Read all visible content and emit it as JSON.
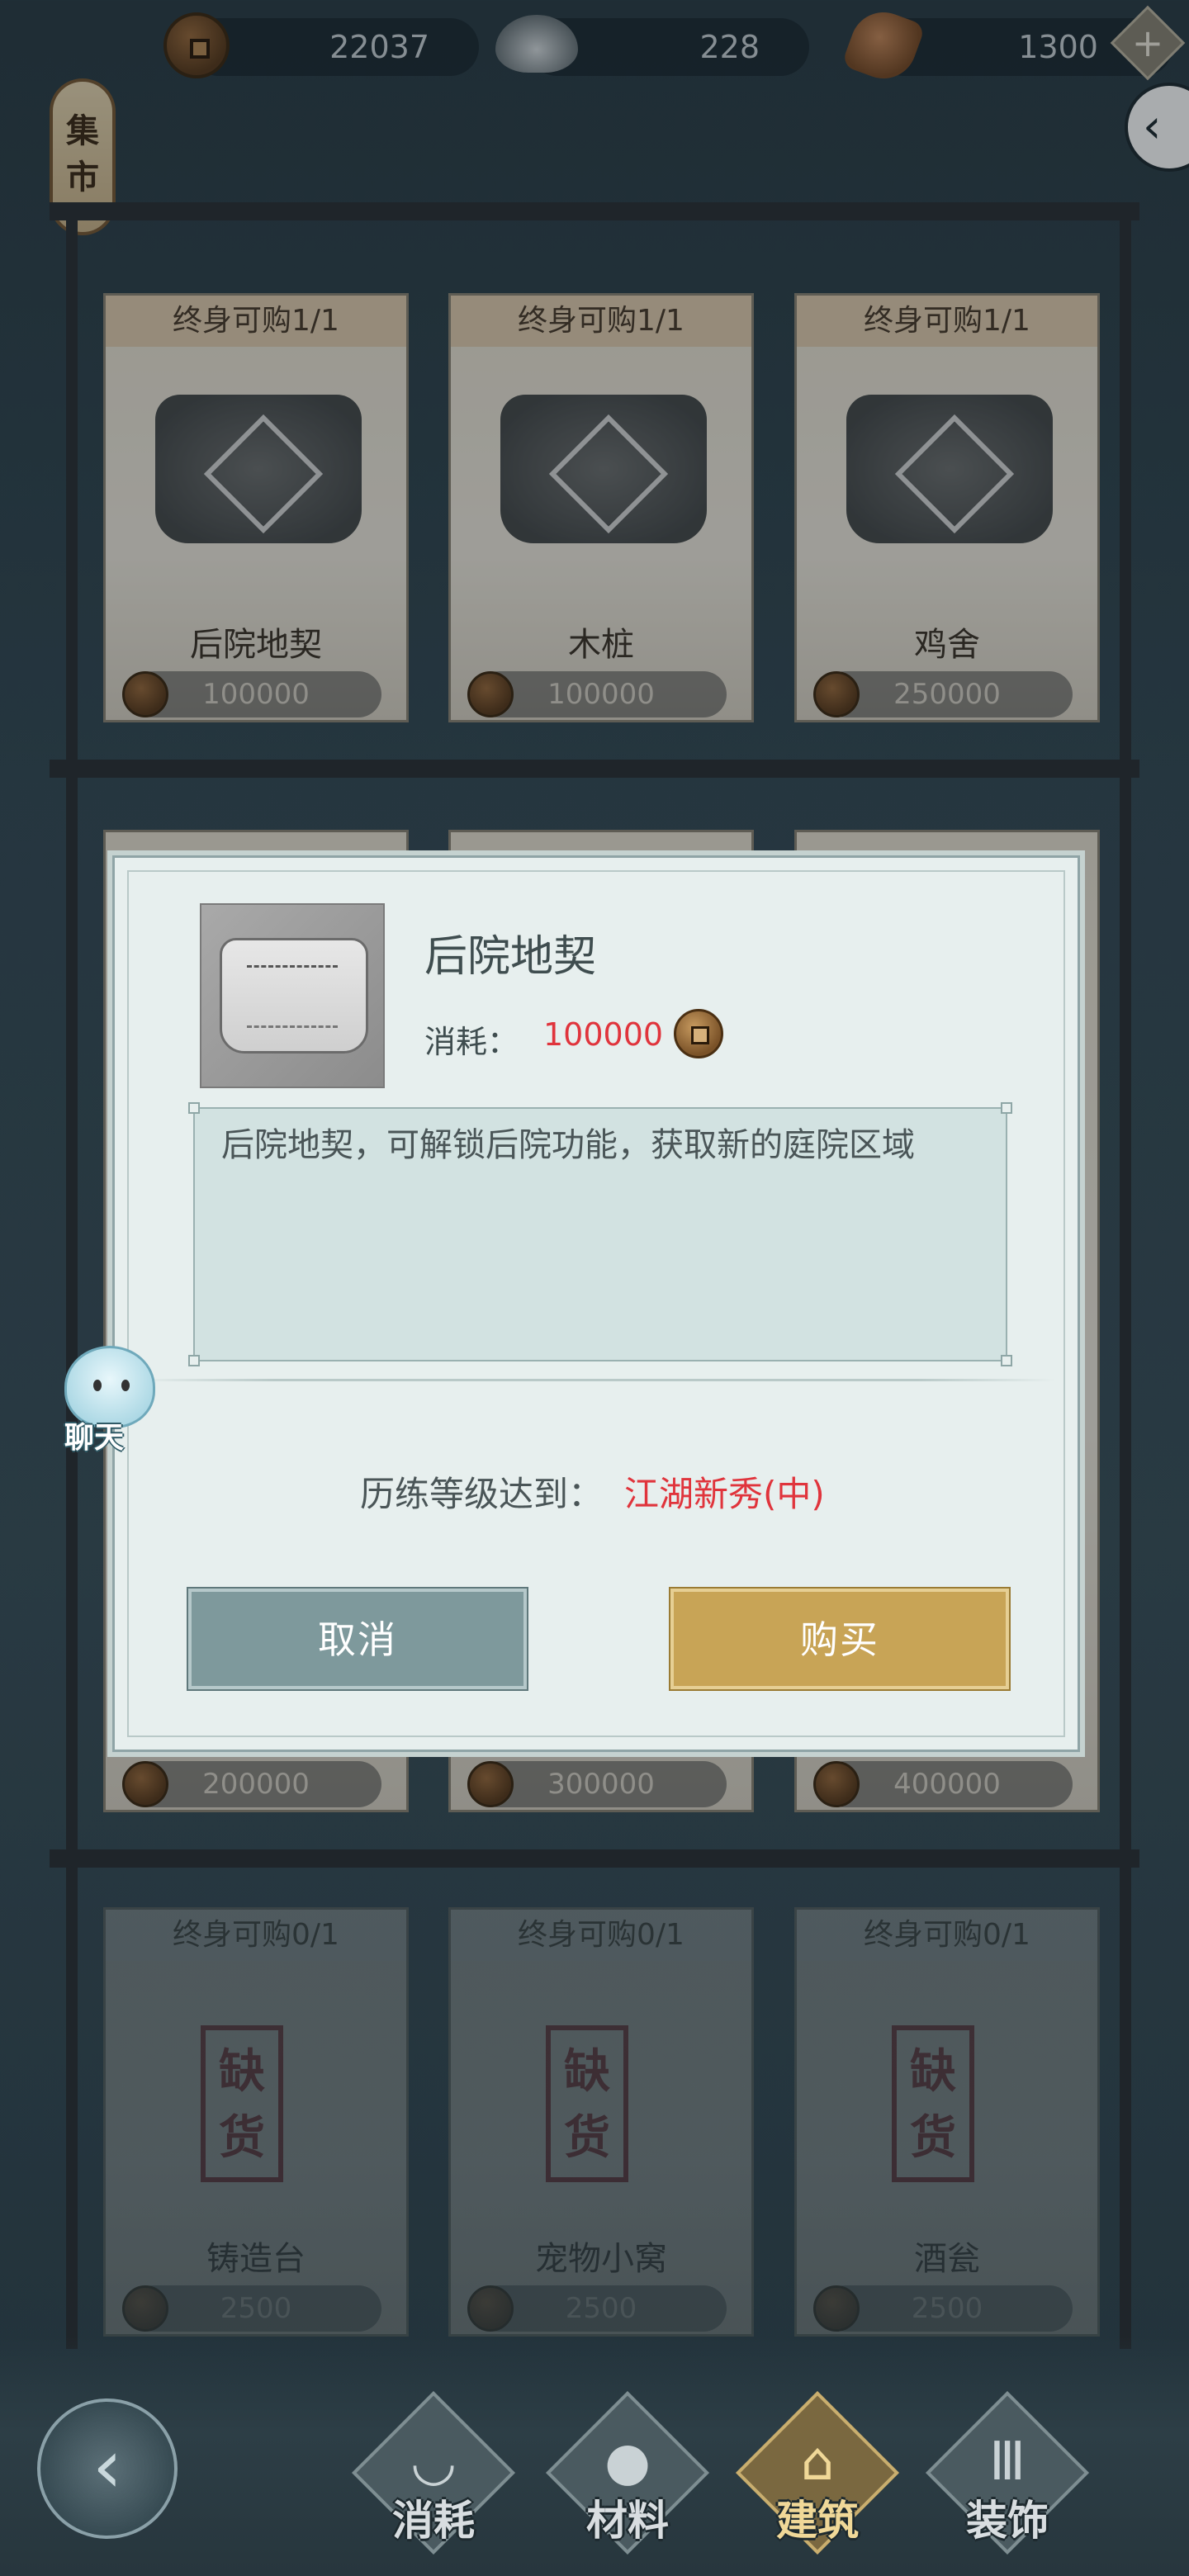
{
  "currency": {
    "coins": "22037",
    "ingots": "228",
    "seeds": "1300",
    "plus_label": "+"
  },
  "market_sign": "集市",
  "back_arrow": "‹",
  "shelf_top": [
    {
      "limit": "终身可购1/1",
      "name": "后院地契",
      "price": "100000"
    },
    {
      "limit": "终身可购1/1",
      "name": "木桩",
      "price": "100000"
    },
    {
      "limit": "终身可购1/1",
      "name": "鸡舍",
      "price": "250000"
    }
  ],
  "shelf_mid_prices": [
    "200000",
    "300000",
    "400000"
  ],
  "shelf_bottom": [
    {
      "limit": "终身可购0/1",
      "name": "铸造台",
      "price": "2500",
      "stamp": "缺货"
    },
    {
      "limit": "终身可购0/1",
      "name": "宠物小窝",
      "price": "2500",
      "stamp": "缺货"
    },
    {
      "limit": "终身可购0/1",
      "name": "酒瓮",
      "price": "2500",
      "stamp": "缺货"
    }
  ],
  "dialog": {
    "title": "后院地契",
    "cost_label": "消耗：",
    "cost_value": "100000",
    "description": "后院地契，可解锁后院功能，获取新的庭院区域",
    "requirement_label": "历练等级达到：",
    "requirement_value": "江湖新秀(中)",
    "cancel_label": "取消",
    "buy_label": "购买"
  },
  "chat_label": "聊天",
  "bottom_nav": {
    "back_glyph": "‹",
    "tabs": [
      {
        "label": "消耗",
        "icon": "bowl-icon",
        "glyph": "◡"
      },
      {
        "label": "材料",
        "icon": "logs-icon",
        "glyph": "●"
      },
      {
        "label": "建筑",
        "icon": "building-icon",
        "glyph": "⌂"
      },
      {
        "label": "装饰",
        "icon": "gate-icon",
        "glyph": "Ⅲ"
      }
    ],
    "active_tab": "建筑"
  },
  "colors": {
    "accent_red": "#e0343c",
    "buy_gold": "#c8a456",
    "cancel_teal": "#7e999c"
  }
}
